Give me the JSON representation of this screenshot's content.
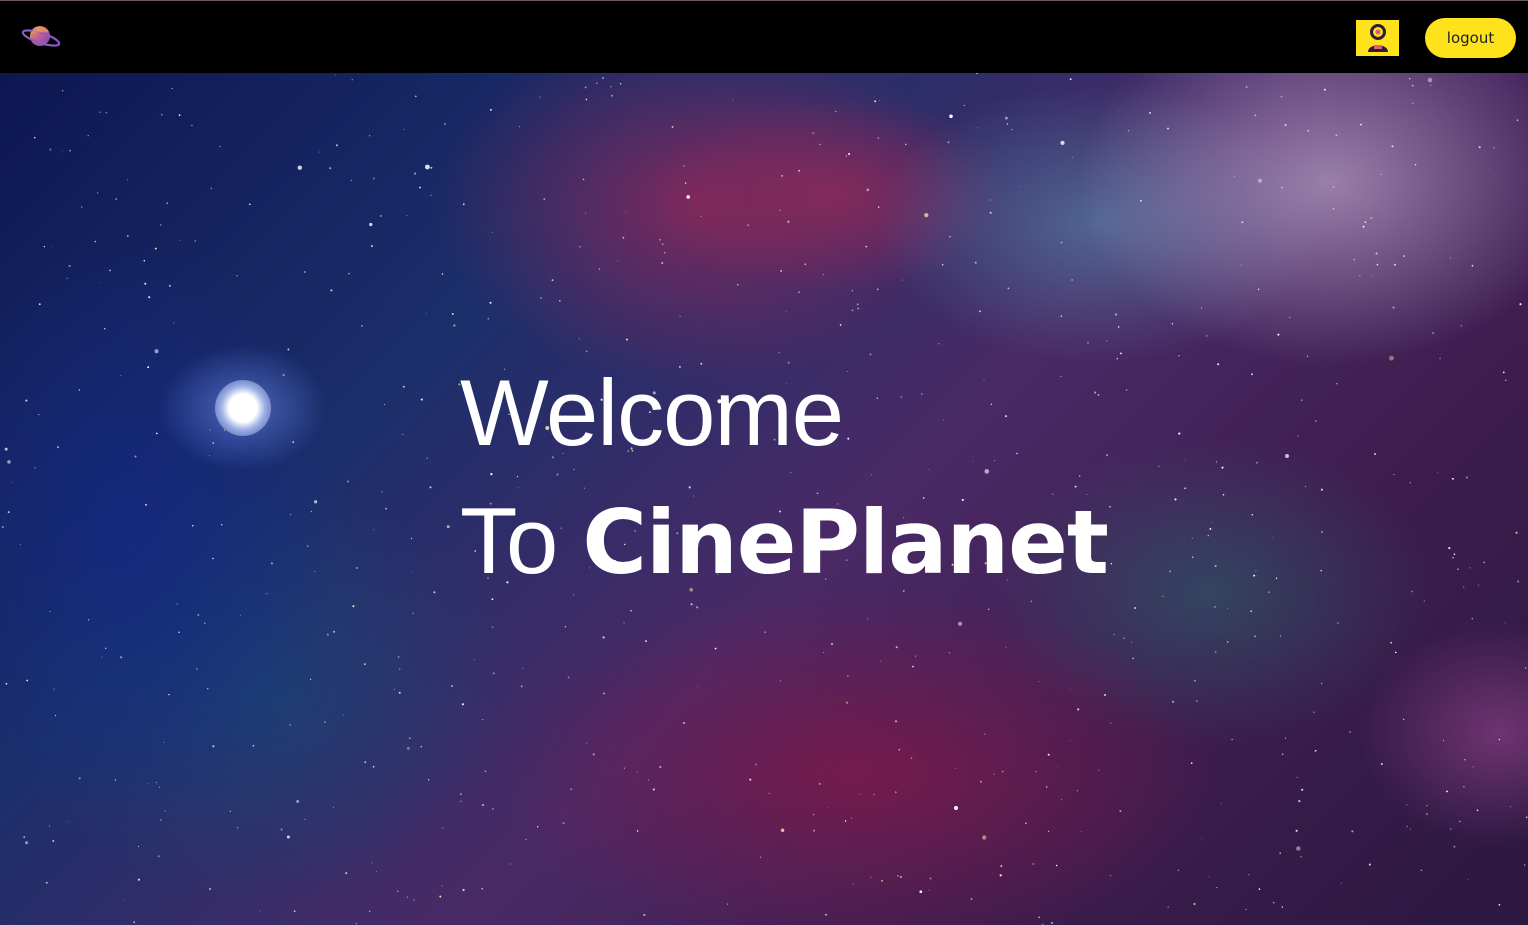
{
  "header": {
    "logo_icon": "planet-icon",
    "avatar_icon": "user-avatar-icon",
    "logout_label": "logout"
  },
  "hero": {
    "welcome_line1": "Welcome",
    "welcome_prefix": "To ",
    "brand_name": "CinePlanet"
  },
  "colors": {
    "accent": "#fde21c",
    "navbar_bg": "#000000",
    "hero_text": "#ffffff"
  }
}
